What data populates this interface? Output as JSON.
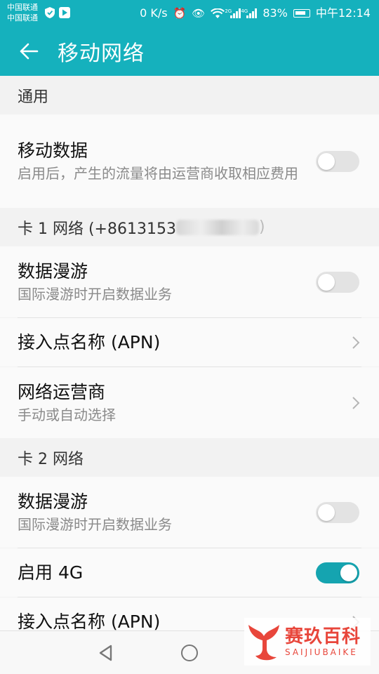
{
  "status_bar": {
    "carrier_1": "中国联通",
    "carrier_2": "中国联通",
    "net_speed": "0 K/s",
    "sim1_tag": "2G",
    "sim2_tag": "4G",
    "battery": "83%",
    "time": "中午12:14"
  },
  "app_bar": {
    "title": "移动网络"
  },
  "sections": {
    "general": {
      "header": "通用",
      "mobile_data": {
        "title": "移动数据",
        "summary": "启用后，产生的流量将由运营商收取相应费用",
        "enabled": false
      }
    },
    "sim1": {
      "header": "卡 1 网络 (+86131​53",
      "header_suffix": ")",
      "roaming": {
        "title": "数据漫游",
        "summary": "国际漫游时开启数据业务",
        "enabled": false
      },
      "apn": {
        "title": "接入点名称 (APN)"
      },
      "operator": {
        "title": "网络运营商",
        "summary": "手动或自动选择"
      }
    },
    "sim2": {
      "header": "卡 2 网络",
      "roaming": {
        "title": "数据漫游",
        "summary": "国际漫游时开启数据业务",
        "enabled": false
      },
      "enable_4g": {
        "title": "启用 4G",
        "enabled": true
      },
      "apn": {
        "title": "接入点名称 (APN)"
      }
    }
  },
  "watermark": {
    "cn": "赛玖百科",
    "en": "SAIJIUBAIKE"
  },
  "colors": {
    "accent": "#15b1bd",
    "toggle_on": "#15a4b0",
    "toggle_off": "#e3e3e3",
    "watermark": "#e8463b"
  }
}
